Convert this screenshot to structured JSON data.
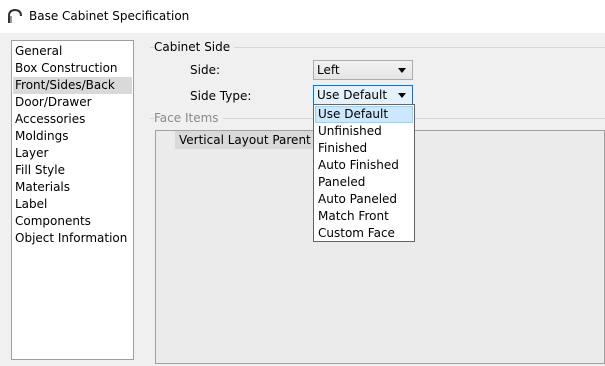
{
  "window": {
    "title": "Base Cabinet Specification",
    "icon": "arch-icon"
  },
  "nav": {
    "items": [
      {
        "label": "General",
        "selected": false
      },
      {
        "label": "Box Construction",
        "selected": false
      },
      {
        "label": "Front/Sides/Back",
        "selected": true
      },
      {
        "label": "Door/Drawer",
        "selected": false
      },
      {
        "label": "Accessories",
        "selected": false
      },
      {
        "label": "Moldings",
        "selected": false
      },
      {
        "label": "Layer",
        "selected": false
      },
      {
        "label": "Fill Style",
        "selected": false
      },
      {
        "label": "Materials",
        "selected": false
      },
      {
        "label": "Label",
        "selected": false
      },
      {
        "label": "Components",
        "selected": false
      },
      {
        "label": "Object Information",
        "selected": false
      }
    ]
  },
  "cabinet_side": {
    "group_label": "Cabinet Side",
    "side_label": "Side:",
    "side_value": "Left",
    "side_type_label": "Side Type:",
    "side_type_value": "Use Default"
  },
  "face_items": {
    "group_label": "Face Items",
    "tree_header": "Vertical Layout Parent"
  },
  "side_type_dropdown": {
    "options": [
      {
        "label": "Use Default",
        "selected": true
      },
      {
        "label": "Unfinished",
        "selected": false
      },
      {
        "label": "Finished",
        "selected": false
      },
      {
        "label": "Auto Finished",
        "selected": false
      },
      {
        "label": "Paneled",
        "selected": false
      },
      {
        "label": "Auto Paneled",
        "selected": false
      },
      {
        "label": "Match Front",
        "selected": false
      },
      {
        "label": "Custom Face",
        "selected": false
      }
    ]
  },
  "colors": {
    "focus_border": "#0078d7",
    "selection_fill": "#cce8ff",
    "nav_selected": "#d9d9d9"
  }
}
